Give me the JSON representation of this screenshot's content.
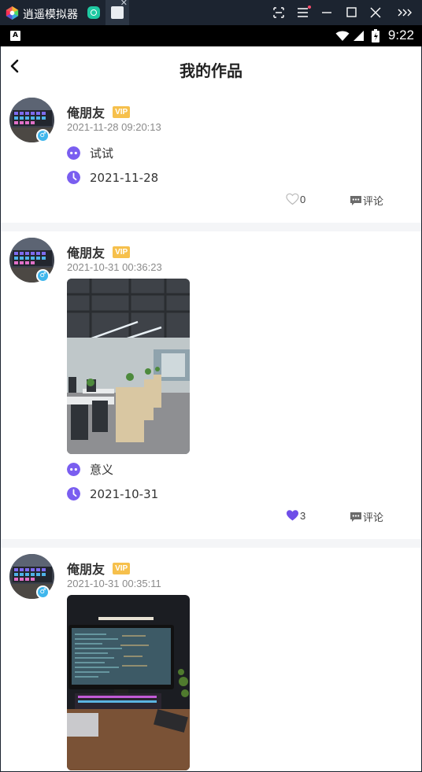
{
  "emulator": {
    "title": "逍遥模拟器",
    "controls": [
      "screenshot-icon",
      "menu-icon",
      "minimize-icon",
      "maximize-icon",
      "close-icon",
      "more-icon"
    ]
  },
  "status_bar": {
    "time": "9:22",
    "notification_icon": "A"
  },
  "header": {
    "title": "我的作品"
  },
  "posts": [
    {
      "username": "俺朋友",
      "vip": "VIP",
      "time": "2021-11-28 09:20:13",
      "has_photo": false,
      "title": "试试",
      "date": "2021-11-28",
      "likes": "0",
      "liked": false,
      "comment_label": "评论"
    },
    {
      "username": "俺朋友",
      "vip": "VIP",
      "time": "2021-10-31 00:36:23",
      "has_photo": true,
      "photo": "office-photo",
      "title": "意义",
      "date": "2021-10-31",
      "likes": "3",
      "liked": true,
      "comment_label": "评论"
    },
    {
      "username": "俺朋友",
      "vip": "VIP",
      "time": "2021-10-31 00:35:11",
      "has_photo": true,
      "photo": "desk-setup-photo"
    }
  ],
  "colors": {
    "accent": "#7a5ef0",
    "vip": "#f6c04c",
    "gender": "#3fb6ec",
    "divider": "#f4f5f7"
  }
}
